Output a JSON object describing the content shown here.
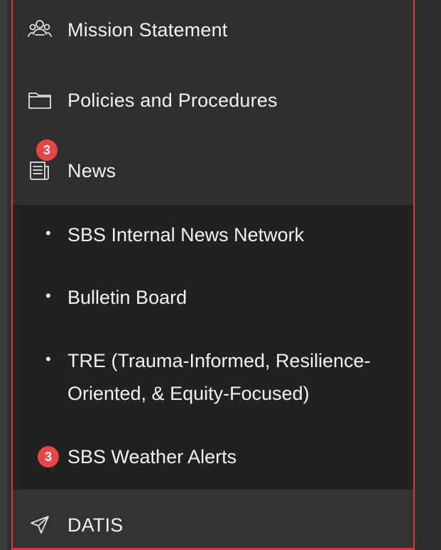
{
  "theme": {
    "accent": "#d8383a",
    "badge": "#e84545",
    "panel": "#2f2f2f",
    "submenu": "#212121",
    "text": "#f2f2f2"
  },
  "menu": {
    "mission": {
      "label": "Mission Statement",
      "icon": "people-icon"
    },
    "policies": {
      "label": "Policies and Procedures",
      "icon": "folder-icon"
    },
    "news": {
      "label": "News",
      "icon": "newspaper-icon",
      "badge": "3"
    },
    "news_items": [
      {
        "label": "SBS Internal News Network"
      },
      {
        "label": "Bulletin Board"
      },
      {
        "label": "TRE (Trauma-Informed, Resilience-Oriented, & Equity-Focused)"
      },
      {
        "label": "SBS Weather Alerts",
        "badge": "3"
      }
    ],
    "datis": {
      "label": "DATIS",
      "icon": "send-icon"
    }
  }
}
